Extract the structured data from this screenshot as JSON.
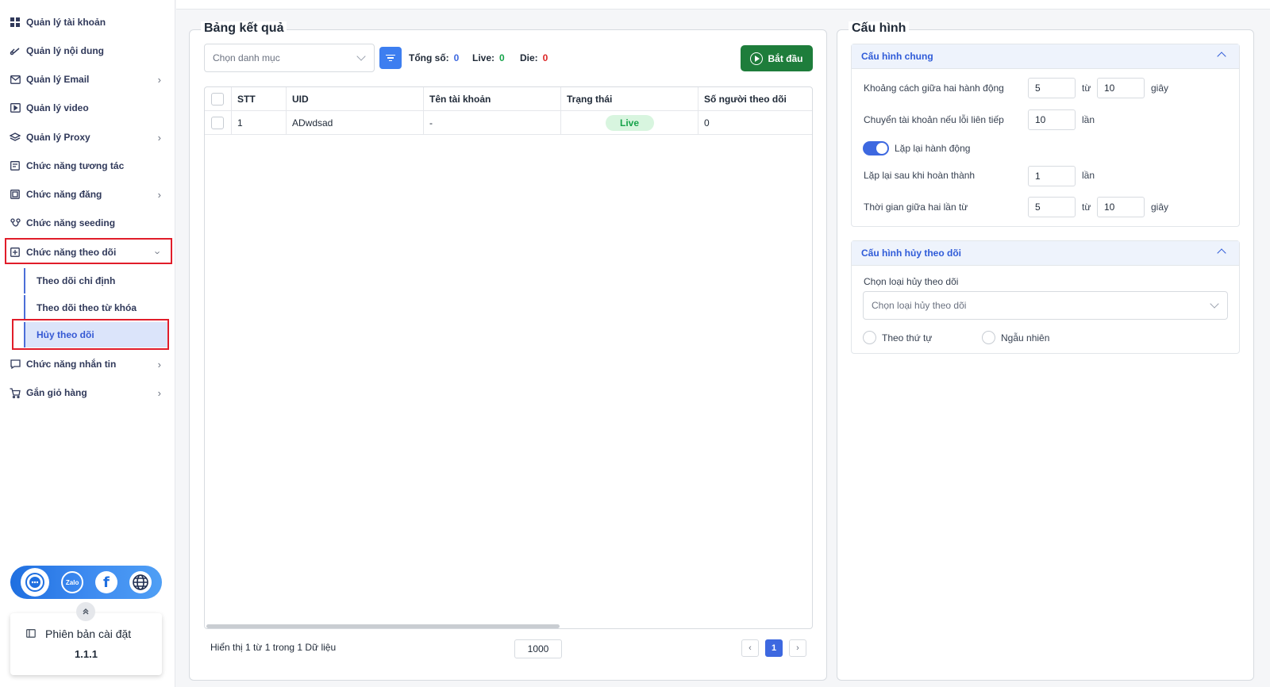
{
  "sidebar": {
    "items": [
      {
        "label": "Quản lý tài khoản",
        "icon": "grid-icon",
        "chevron": false
      },
      {
        "label": "Quản lý nội dung",
        "icon": "link-icon",
        "chevron": false
      },
      {
        "label": "Quản lý Email",
        "icon": "mail-icon",
        "chevron": true
      },
      {
        "label": "Quản lý video",
        "icon": "video-icon",
        "chevron": false
      },
      {
        "label": "Quản lý Proxy",
        "icon": "layers-icon",
        "chevron": true
      },
      {
        "label": "Chức năng tương tác",
        "icon": "chat-square-icon",
        "chevron": false
      },
      {
        "label": "Chức năng đăng",
        "icon": "post-icon",
        "chevron": true
      },
      {
        "label": "Chức năng seeding",
        "icon": "branch-icon",
        "chevron": false
      },
      {
        "label": "Chức năng theo dõi",
        "icon": "follow-icon",
        "chevron": true
      },
      {
        "label": "Chức năng nhắn tin",
        "icon": "message-icon",
        "chevron": true
      },
      {
        "label": "Gắn giỏ hàng",
        "icon": "cart-icon",
        "chevron": true
      }
    ],
    "sub_items": [
      "Theo dõi chỉ định",
      "Theo dõi theo từ khóa",
      "Hủy theo dõi"
    ],
    "social": {
      "zalo": "Zalo",
      "facebook": "f"
    },
    "version_label": "Phiên bản cài đặt",
    "version_number": "1.1.1"
  },
  "results": {
    "title": "Bảng kết quả",
    "category_placeholder": "Chọn danh mục",
    "total_label": "Tổng số:",
    "total_value": "0",
    "live_label": "Live:",
    "live_value": "0",
    "die_label": "Die:",
    "die_value": "0",
    "start_label": "Bắt đầu",
    "columns": [
      "STT",
      "UID",
      "Tên tài khoản",
      "Trạng thái",
      "Số người theo dõi"
    ],
    "rows": [
      {
        "stt": "1",
        "uid": "ADwdsad",
        "name": "-",
        "status": "Live",
        "followers": "0"
      }
    ],
    "footer_text": "Hiển thị 1 từ 1 trong 1 Dữ liệu",
    "page_size": "1000",
    "current_page": "1",
    "prev": "‹",
    "next": "›"
  },
  "config": {
    "title": "Cấu hình",
    "general": {
      "title": "Cấu hình chung",
      "interval_label": "Khoảng cách giữa hai hành động",
      "interval_from": "5",
      "tu": "từ",
      "interval_to": "10",
      "giay": "giây",
      "switch_label": "Chuyển tài khoản nếu lỗi liên tiếp",
      "switch_value": "10",
      "lan": "lần",
      "repeat_label": "Lặp lại hành động",
      "repeat_on": true,
      "repeat_after_label": "Lặp lại sau khi hoàn thành",
      "repeat_after_value": "1",
      "between_label": "Thời gian giữa hai lần từ",
      "between_from": "5",
      "between_to": "10"
    },
    "unfollow": {
      "title": "Cấu hình hủy theo dõi",
      "type_label": "Chọn loại hủy theo dõi",
      "type_placeholder": "Chọn loại hủy theo dõi",
      "order_label": "Theo thứ tự",
      "random_label": "Ngẫu nhiên"
    }
  },
  "colors": {
    "accent": "#3d68e0",
    "start": "#1e7d3b",
    "live": "#16a34a",
    "die": "#dc2626",
    "highlight": "#e11d2a"
  }
}
